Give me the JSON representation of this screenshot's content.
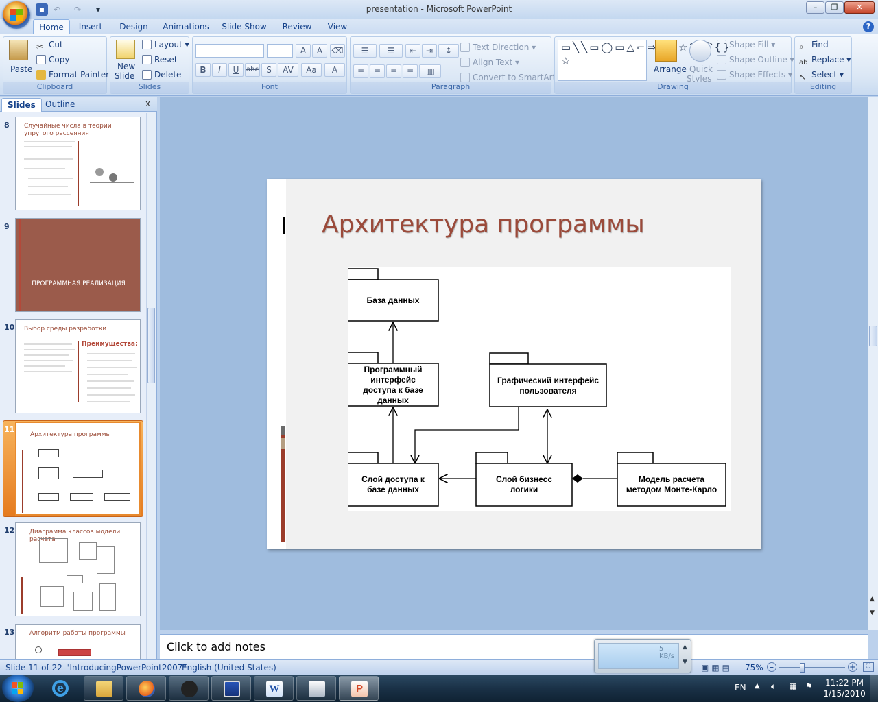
{
  "window": {
    "title": "presentation - Microsoft PowerPoint"
  },
  "ribbon_tabs": [
    "Home",
    "Insert",
    "Design",
    "Animations",
    "Slide Show",
    "Review",
    "View"
  ],
  "clipboard": {
    "paste": "Paste",
    "cut": "Cut",
    "copy": "Copy",
    "format_painter": "Format Painter",
    "label": "Clipboard"
  },
  "slides_group": {
    "new_slide_1": "New",
    "new_slide_2": "Slide",
    "layout": "Layout",
    "reset": "Reset",
    "delete": "Delete",
    "label": "Slides"
  },
  "font_group": {
    "label": "Font"
  },
  "paragraph_group": {
    "text_direction": "Text Direction",
    "align_text": "Align Text",
    "convert_smartart": "Convert to SmartArt",
    "label": "Paragraph"
  },
  "drawing_group": {
    "arrange": "Arrange",
    "quick_styles_1": "Quick",
    "quick_styles_2": "Styles",
    "shape_fill": "Shape Fill",
    "shape_outline": "Shape Outline",
    "shape_effects": "Shape Effects",
    "label": "Drawing"
  },
  "editing_group": {
    "find": "Find",
    "replace": "Replace",
    "select": "Select",
    "label": "Editing"
  },
  "pane_tabs": {
    "slides": "Slides",
    "outline": "Outline"
  },
  "thumbnails": [
    {
      "num": "8",
      "title": "Случайные числа в теории упругого рассеяния"
    },
    {
      "num": "9",
      "title": "ПРОГРАММНАЯ РЕАЛИЗАЦИЯ"
    },
    {
      "num": "10",
      "title": "Выбор среды разработки",
      "sub": "Преимущества:"
    },
    {
      "num": "11",
      "title": "Архитектура программы"
    },
    {
      "num": "12",
      "title": "Диаграмма классов модели расчета"
    },
    {
      "num": "13",
      "title": "Алгоритм работы программы"
    }
  ],
  "slide": {
    "title": "Архитектура программы",
    "diagram": {
      "db": "База данных",
      "api_1": "Программный",
      "api_2": "интерфейс",
      "api_3": "доступа к базе",
      "api_4": "данных",
      "gui_1": "Графический интерфейс",
      "gui_2": "пользователя",
      "dal_1": "Слой доступа к",
      "dal_2": "базе данных",
      "bl_1": "Слой бизнесс",
      "bl_2": "логики",
      "mc_1": "Модель расчета",
      "mc_2": "методом Монте-Карло"
    }
  },
  "notes": {
    "placeholder": "Click to add notes"
  },
  "status": {
    "slide": "Slide 11 of 22",
    "theme": "\"IntroducingPowerPoint2007\"",
    "language": "English (United States)",
    "zoom": "75%"
  },
  "net_widget": {
    "speed": "5 KB/s"
  },
  "tray": {
    "lang": "EN",
    "time": "11:22 PM",
    "date": "1/15/2010"
  }
}
